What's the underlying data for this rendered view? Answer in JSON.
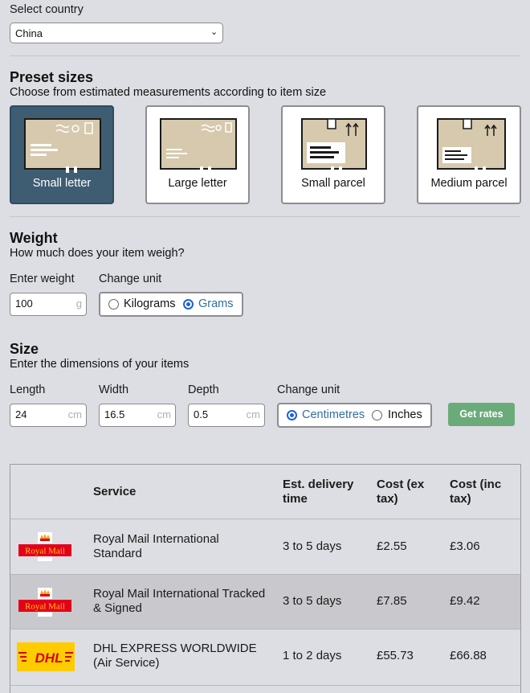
{
  "country": {
    "label": "Select country",
    "value": "China"
  },
  "presets": {
    "title": "Preset sizes",
    "subtitle": "Choose from estimated measurements according to item size",
    "items": [
      {
        "label": "Small letter",
        "selected": true
      },
      {
        "label": "Large letter",
        "selected": false
      },
      {
        "label": "Small parcel",
        "selected": false
      },
      {
        "label": "Medium parcel",
        "selected": false
      }
    ]
  },
  "weight": {
    "title": "Weight",
    "subtitle": "How much does your item weigh?",
    "enter_label": "Enter weight",
    "value": "100",
    "unit_suffix": "g",
    "change_unit_label": "Change unit",
    "options": [
      "Kilograms",
      "Grams"
    ],
    "selected": "Grams"
  },
  "size": {
    "title": "Size",
    "subtitle": "Enter the dimensions of your items",
    "length_label": "Length",
    "length_value": "24",
    "width_label": "Width",
    "width_value": "16.5",
    "depth_label": "Depth",
    "depth_value": "0.5",
    "unit_suffix": "cm",
    "change_unit_label": "Change unit",
    "options": [
      "Centimetres",
      "Inches"
    ],
    "selected": "Centimetres",
    "button": "Get rates"
  },
  "table": {
    "headers": [
      "Service",
      "Est. delivery time",
      "Cost (ex tax)",
      "Cost (inc tax)"
    ],
    "rows": [
      {
        "carrier": "Royal Mail",
        "logo": "royal-mail-logo",
        "service": "Royal Mail International Standard",
        "time": "3 to 5 days",
        "ex": "£2.55",
        "inc": "£3.06"
      },
      {
        "carrier": "Royal Mail",
        "logo": "royal-mail-logo",
        "service": "Royal Mail International Tracked & Signed",
        "time": "3 to 5 days",
        "ex": "£7.85",
        "inc": "£9.42"
      },
      {
        "carrier": "DHL",
        "logo": "dhl-logo",
        "service": "DHL EXPRESS WORLDWIDE (Air Service)",
        "time": "1 to 2 days",
        "ex": "£55.73",
        "inc": "£66.88"
      }
    ]
  },
  "colors": {
    "background": "#dddee3",
    "selected_preset": "#3e5d72",
    "button": "#6aab79",
    "royal_mail_red": "#e2001a",
    "dhl_yellow": "#ffcc00",
    "dhl_red": "#d40511"
  }
}
